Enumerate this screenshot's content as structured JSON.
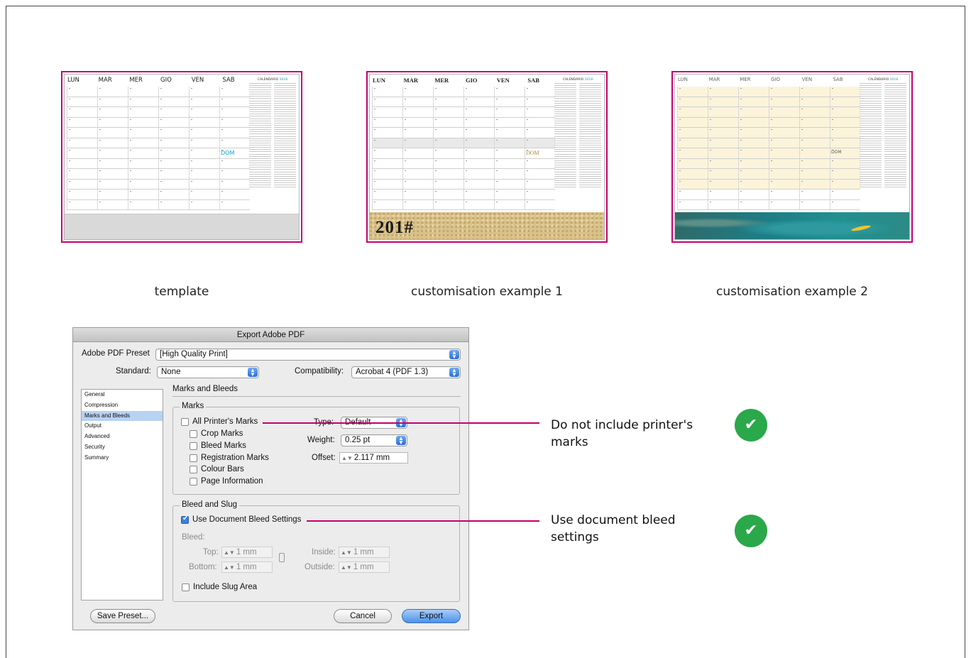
{
  "calendar": {
    "days": [
      "LUN",
      "MAR",
      "MER",
      "GIO",
      "VEN",
      "SAB"
    ],
    "dom_label": "DOM",
    "mini_title": "CALENDARIO",
    "mini_year": "2018",
    "footer_text": "201#"
  },
  "captions": {
    "template": "template",
    "example1": "customisation example 1",
    "example2": "customisation example 2"
  },
  "dialog": {
    "title": "Export Adobe PDF",
    "preset_label": "Adobe PDF Preset",
    "preset_value": "[High Quality Print]",
    "standard_label": "Standard:",
    "standard_value": "None",
    "compat_label": "Compatibility:",
    "compat_value": "Acrobat 4 (PDF 1.3)",
    "nav": [
      "General",
      "Compression",
      "Marks and Bleeds",
      "Output",
      "Advanced",
      "Security",
      "Summary"
    ],
    "section_title": "Marks and Bleeds",
    "marks": {
      "group_label": "Marks",
      "all": "All Printer's Marks",
      "crop": "Crop Marks",
      "bleed": "Bleed Marks",
      "registration": "Registration Marks",
      "colour": "Colour Bars",
      "page_info": "Page Information",
      "type_label": "Type:",
      "type_value": "Default",
      "weight_label": "Weight:",
      "weight_value": "0.25 pt",
      "offset_label": "Offset:",
      "offset_value": "2.117 mm"
    },
    "bleed": {
      "group_label": "Bleed and Slug",
      "use_doc": "Use Document Bleed Settings",
      "bleed_label": "Bleed:",
      "top_label": "Top:",
      "top_value": "1 mm",
      "bottom_label": "Bottom:",
      "bottom_value": "1 mm",
      "inside_label": "Inside:",
      "inside_value": "1 mm",
      "outside_label": "Outside:",
      "outside_value": "1 mm",
      "slug": "Include Slug Area"
    },
    "buttons": {
      "save_preset": "Save Preset...",
      "cancel": "Cancel",
      "export": "Export"
    }
  },
  "notes": {
    "note1": "Do not include printer's marks",
    "note2": "Use document bleed settings"
  },
  "colors": {
    "accent": "#c4006b",
    "check": "#2aa84a"
  }
}
